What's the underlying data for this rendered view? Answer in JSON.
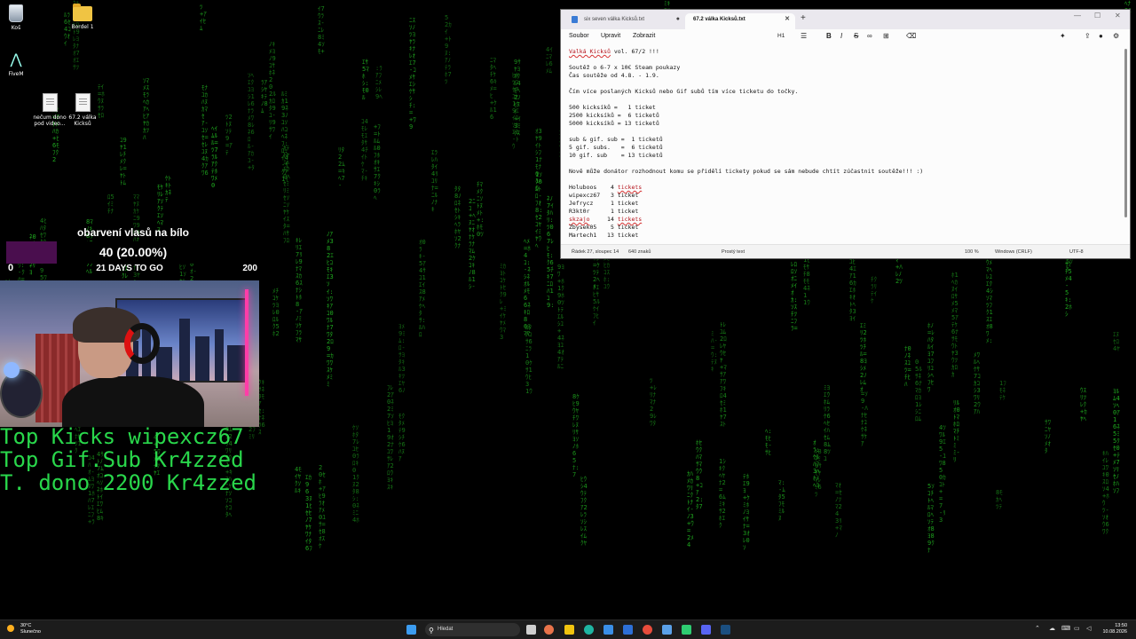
{
  "desktop": {
    "icons": [
      {
        "label": "Koš",
        "icon": "recycle-bin-icon"
      },
      {
        "label": "Bordel 1",
        "icon": "folder-icon"
      },
      {
        "label": "FiveM",
        "icon": "fivem-icon"
      },
      {
        "label": "nečum dono pod video...",
        "icon": "text-file-icon"
      },
      {
        "label": "67.2 válka Kicksů",
        "icon": "text-file-icon"
      }
    ]
  },
  "goal": {
    "title": "obarvení vlasů na bílo",
    "amount": "40 (20.00%)",
    "progress": 0.2,
    "min": "0",
    "days_left": "21 DAYS TO GO",
    "max": "200",
    "fill_color": "#4a0e4e"
  },
  "top_lines": [
    "Top Kicks wipexcz67",
    "Top Gif.Sub Kr4zzed",
    "T. dono 2200 Kr4zzed"
  ],
  "notepad": {
    "tabs": [
      {
        "label": "six seven válka Kicksů.txt",
        "active": false
      },
      {
        "label": "67.2 válka Kicksů.txt",
        "active": true
      }
    ],
    "menu": [
      "Soubor",
      "Upravit",
      "Zobrazit"
    ],
    "toolbar": {
      "heading": "H1"
    },
    "lines": [
      {
        "pre": "",
        "err": "Valká Kicksů",
        "post": " vol. 67/2 !!!"
      },
      {
        "pre": "",
        "err": "",
        "post": ""
      },
      {
        "pre": "Soutěž o 6-7 x 10€ Steam poukazy",
        "err": "",
        "post": ""
      },
      {
        "pre": "Čas soutěže od 4.8. - 1.9.",
        "err": "",
        "post": ""
      },
      {
        "pre": "",
        "err": "",
        "post": ""
      },
      {
        "pre": "Čím více poslaných Kicksů nebo Gif subů tím více ticketu do točky.",
        "err": "",
        "post": ""
      },
      {
        "pre": "",
        "err": "",
        "post": ""
      },
      {
        "pre": "500 kicksíků =   1 ticket",
        "err": "",
        "post": ""
      },
      {
        "pre": "2500 kicksíků =  6 ticketů",
        "err": "",
        "post": ""
      },
      {
        "pre": "5000 kicksíků = 13 ticketů",
        "err": "",
        "post": ""
      },
      {
        "pre": "",
        "err": "",
        "post": ""
      },
      {
        "pre": "sub & gif. sub =  1 ticketů",
        "err": "",
        "post": ""
      },
      {
        "pre": "5 gif. subs.   =  6 ticketů",
        "err": "",
        "post": ""
      },
      {
        "pre": "10 gif. sub    = 13 ticketů",
        "err": "",
        "post": ""
      },
      {
        "pre": "",
        "err": "",
        "post": ""
      },
      {
        "pre": "Nově může donátor rozhodnout komu se přidělí tickety pokud se sám nebude chtít zúčastnit soutěže!!! :)",
        "err": "",
        "post": ""
      },
      {
        "pre": "",
        "err": "",
        "post": ""
      },
      {
        "pre": "Holuboos    4 ",
        "err": "tickets",
        "post": ""
      },
      {
        "pre": "wipexcz67   3 ticket",
        "err": "",
        "post": ""
      },
      {
        "pre": "Jefrycz     1 ticket",
        "err": "",
        "post": ""
      },
      {
        "pre": "R3kt0r      1 ticket",
        "err": "",
        "post": ""
      },
      {
        "pre": "",
        "err": "skzajo",
        "post": "     14 "
      },
      {
        "pre": "Zbysek05    5 ticket",
        "err": "",
        "post": ""
      },
      {
        "pre": "Martech1   13 ticket",
        "err": "",
        "post": ""
      }
    ],
    "line21_tail": "tickets",
    "status": {
      "position": "Řádek 27, sloupec 14",
      "chars": "640 znaků",
      "format": "Prostý text",
      "zoom": "100 %",
      "eol": "Windows (CRLF)",
      "encoding": "UTF-8"
    }
  },
  "taskbar": {
    "weather_temp": "30°C",
    "weather_desc": "Slunečno",
    "search_placeholder": "Hledat",
    "time": "13:50",
    "date": "10.08.2026"
  }
}
